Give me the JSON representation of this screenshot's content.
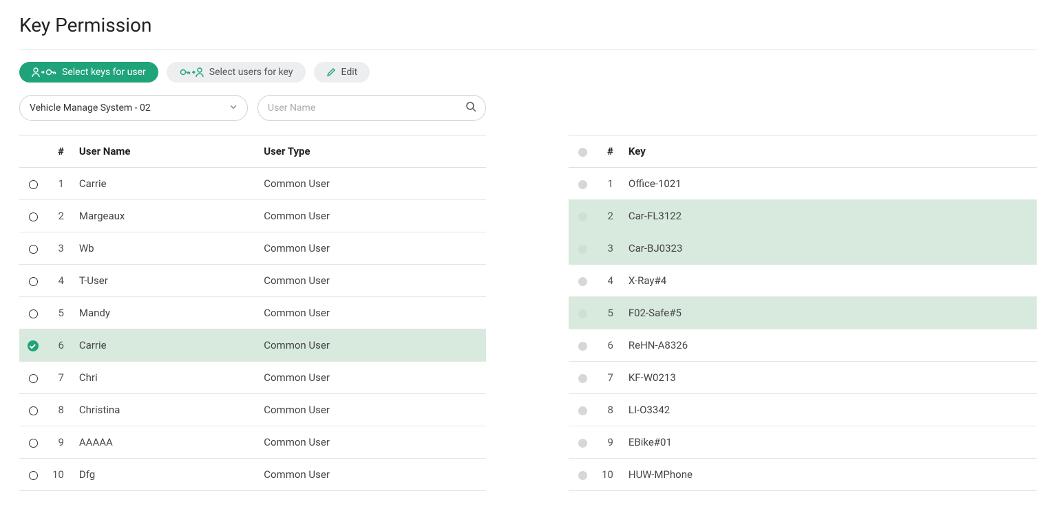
{
  "pageTitle": "Key Permission",
  "toolbar": {
    "selectKeysForUser": "Select keys for user",
    "selectUsersForKey": "Select users for key",
    "edit": "Edit"
  },
  "filters": {
    "systemSelected": "Vehicle Manage System - 02",
    "searchPlaceholder": "User Name"
  },
  "usersTable": {
    "headers": {
      "num": "#",
      "name": "User Name",
      "type": "User Type"
    },
    "rows": [
      {
        "num": 1,
        "name": "Carrie",
        "type": "Common User",
        "selected": false
      },
      {
        "num": 2,
        "name": "Margeaux",
        "type": "Common User",
        "selected": false
      },
      {
        "num": 3,
        "name": "Wb",
        "type": "Common User",
        "selected": false
      },
      {
        "num": 4,
        "name": "T-User",
        "type": "Common User",
        "selected": false
      },
      {
        "num": 5,
        "name": "Mandy",
        "type": "Common User",
        "selected": false
      },
      {
        "num": 6,
        "name": "Carrie",
        "type": "Common User",
        "selected": true
      },
      {
        "num": 7,
        "name": "Chri",
        "type": "Common User",
        "selected": false
      },
      {
        "num": 8,
        "name": "Christina",
        "type": "Common User",
        "selected": false
      },
      {
        "num": 9,
        "name": "AAAAA",
        "type": "Common User",
        "selected": false
      },
      {
        "num": 10,
        "name": "Dfg",
        "type": "Common User",
        "selected": false
      }
    ]
  },
  "keysTable": {
    "headers": {
      "num": "#",
      "key": "Key"
    },
    "rows": [
      {
        "num": 1,
        "key": "Office-1021",
        "selected": false
      },
      {
        "num": 2,
        "key": "Car-FL3122",
        "selected": true
      },
      {
        "num": 3,
        "key": "Car-BJ0323",
        "selected": true
      },
      {
        "num": 4,
        "key": "X-Ray#4",
        "selected": false
      },
      {
        "num": 5,
        "key": "F02-Safe#5",
        "selected": true
      },
      {
        "num": 6,
        "key": "ReHN-A8326",
        "selected": false
      },
      {
        "num": 7,
        "key": "KF-W0213",
        "selected": false
      },
      {
        "num": 8,
        "key": "LI-O3342",
        "selected": false
      },
      {
        "num": 9,
        "key": "EBike#01",
        "selected": false
      },
      {
        "num": 10,
        "key": "HUW-MPhone",
        "selected": false
      }
    ]
  }
}
